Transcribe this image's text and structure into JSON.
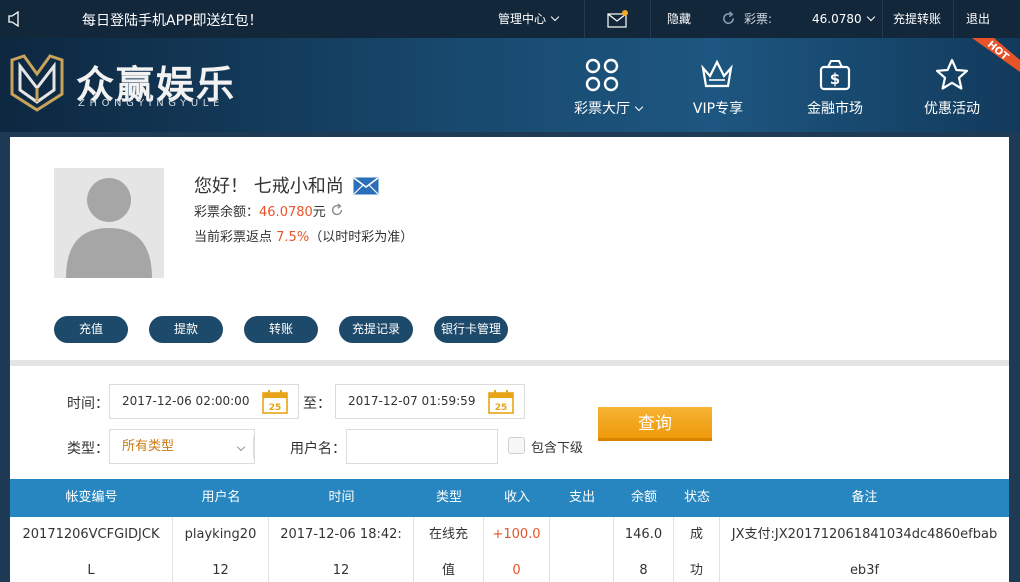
{
  "topbar": {
    "notice": "每日登陆手机APP即送红包！",
    "manage_center": "管理中心",
    "hide_label": "隐藏",
    "lottery_label": "彩票:",
    "balance": "46.0780",
    "recharge_transfer": "充提转账",
    "logout": "退出"
  },
  "brand": {
    "name_cn": "众赢娱乐",
    "name_en": "ZHONGYINGYULE"
  },
  "nav": {
    "items": [
      {
        "label": "彩票大厅",
        "icon": "grid-icon"
      },
      {
        "label": "VIP专享",
        "icon": "crown-icon"
      },
      {
        "label": "金融市场",
        "icon": "money-bag-icon"
      },
      {
        "label": "优惠活动",
        "icon": "star-icon"
      }
    ],
    "hot_tag": "HOT"
  },
  "profile": {
    "greeting": "您好！ 七戒小和尚",
    "balance_label": "彩票余额：",
    "balance_value": "46.0780",
    "balance_unit": "元",
    "rebate_label": "当前彩票返点",
    "rebate_value": "7.5%",
    "rebate_note": "（以时时彩为准）"
  },
  "actions": [
    "充值",
    "提款",
    "转账",
    "充提记录",
    "银行卡管理"
  ],
  "filter": {
    "time_label": "时间：",
    "start": "2017-12-06 02:00:00",
    "to_label": "至：",
    "end": "2017-12-07 01:59:59",
    "calendar_day": "25",
    "type_label": "类型：",
    "type_value": "所有类型",
    "username_label": "用户名：",
    "username_value": "",
    "include_sub": "包含下级",
    "search": "查询"
  },
  "table": {
    "headers": [
      "帐变编号",
      "用户名",
      "时间",
      "类型",
      "收入",
      "支出",
      "余额",
      "状态",
      "备注"
    ],
    "rows": [
      {
        "id": [
          "20171206VCFGIDJCK",
          "L"
        ],
        "user": [
          "playking20",
          "12"
        ],
        "time": [
          "2017-12-06 18:42:",
          "12"
        ],
        "type": [
          "在线充",
          "值"
        ],
        "income": [
          "+100.0",
          "0"
        ],
        "expense": [
          "",
          ""
        ],
        "balance": [
          "146.0",
          "8"
        ],
        "status": [
          "成",
          "功"
        ],
        "note": [
          "JX支付:JX201712061841034dc4860efbab",
          "eb3f"
        ]
      }
    ]
  },
  "colors": {
    "accent_orange": "#ee9a0a",
    "table_header": "#2786c0",
    "button_dark": "#1d4a6a",
    "income_red": "#e8542a"
  }
}
